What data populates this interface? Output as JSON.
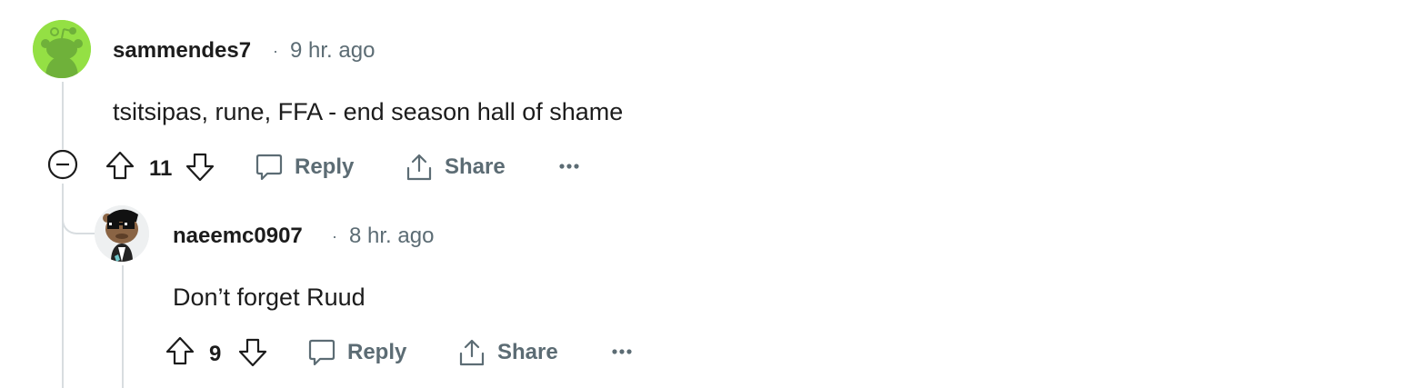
{
  "comments": [
    {
      "username": "sammendes7",
      "separator": "·",
      "timestamp": "9 hr. ago",
      "body": "tsitsipas, rune, FFA - end season hall of shame",
      "votes": "11",
      "reply_label": "Reply",
      "share_label": "Share",
      "avatar_color": "#94e044"
    },
    {
      "username": "naeemc0907",
      "separator": "·",
      "timestamp": "8 hr. ago",
      "body": "Don’t forget Ruud",
      "votes": "9",
      "reply_label": "Reply",
      "share_label": "Share",
      "avatar_color": "#eef0f1"
    }
  ],
  "colors": {
    "meta_text": "#5c6c74",
    "thread_line": "#d8dde0",
    "primary_text": "#1c1c1c"
  },
  "icons": {
    "collapse": "minus-circle-icon",
    "upvote": "arrow-up-icon",
    "downvote": "arrow-down-icon",
    "reply": "speech-bubble-icon",
    "share": "share-upload-icon",
    "more": "ellipsis-icon"
  }
}
